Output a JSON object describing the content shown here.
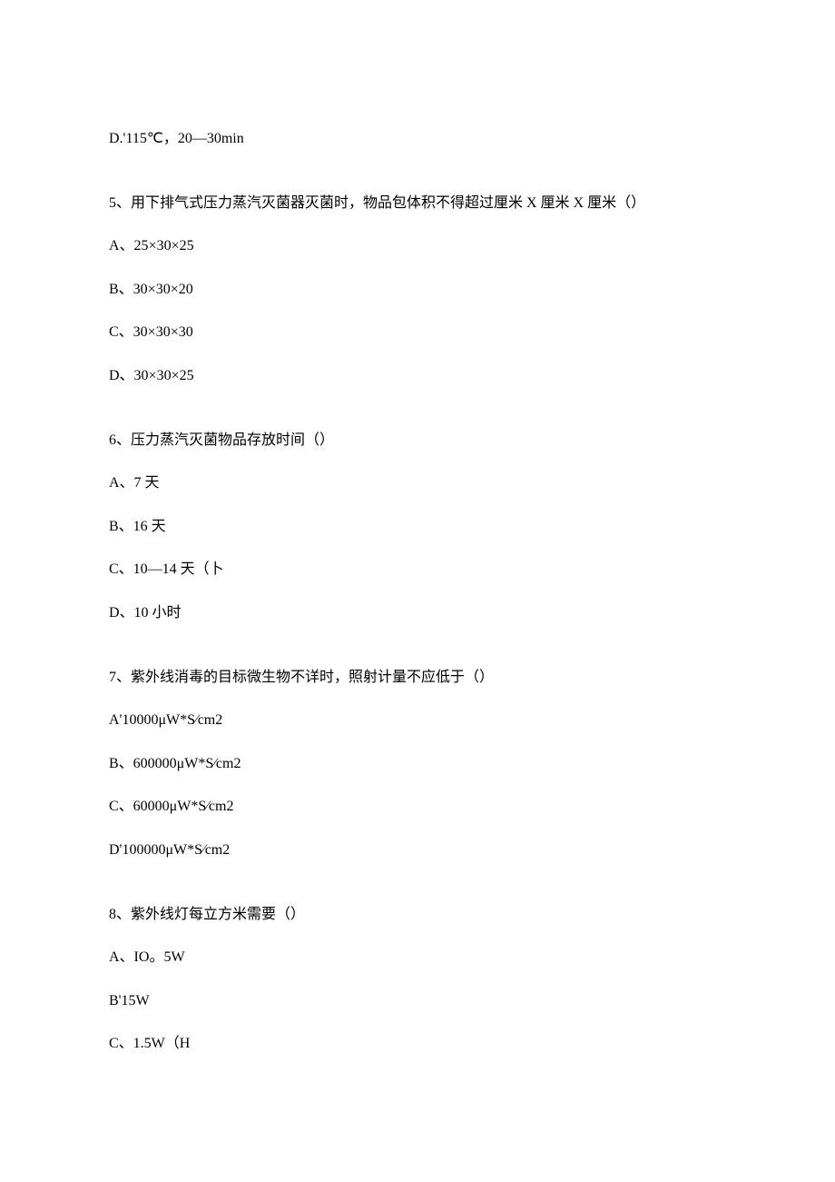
{
  "line1": "D.'115℃，20—30min",
  "q5": {
    "stem": "5、用下排气式压力蒸汽灭菌器灭菌时，物品包体积不得超过厘米 X 厘米 X 厘米（）",
    "a": "A、25×30×25",
    "b": "B、30×30×20",
    "c": "C、30×30×30",
    "d": "D、30×30×25"
  },
  "q6": {
    "stem": "6、压力蒸汽灭菌物品存放时间（）",
    "a": "A、7 天",
    "b": "B、16 天",
    "c": "C、10—14 天（卜",
    "d": "D、10 小时"
  },
  "q7": {
    "stem": "7、紫外线消毒的目标微生物不详时，照射计量不应低于（）",
    "a": "A'10000μW*S⁄cm2",
    "b": "B、600000μW*S⁄cm2",
    "c": "C、60000μW*S⁄cm2",
    "d": "D'100000μW*S⁄cm2"
  },
  "q8": {
    "stem": "8、紫外线灯每立方米需要（）",
    "a": "A、IO。5W",
    "b": "B'15W",
    "c": "C、1.5W（H"
  }
}
